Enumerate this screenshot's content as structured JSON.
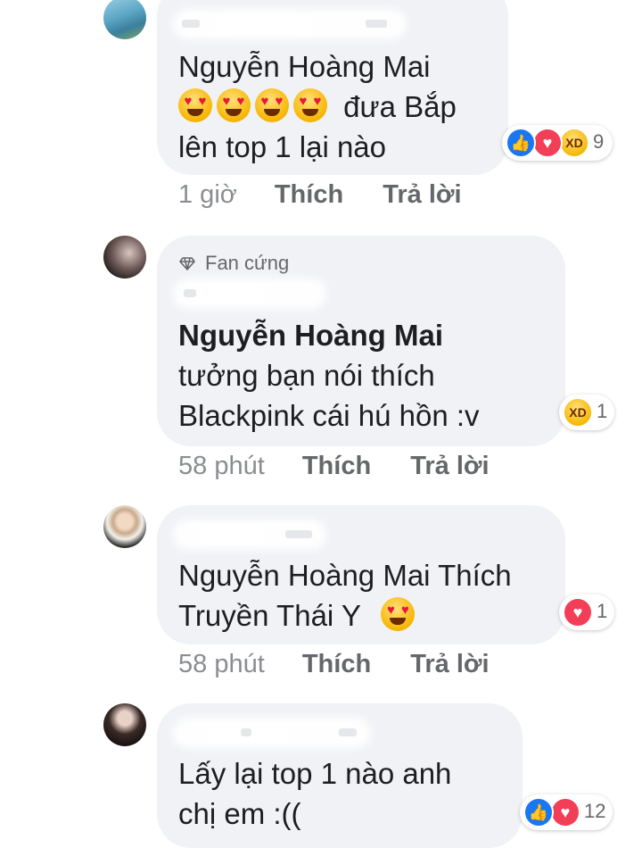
{
  "comments": [
    {
      "lines": [
        "Nguyễn Hoàng Mai",
        "đưa Bắp",
        "lên top 1 lại nào"
      ],
      "time": "1 giờ",
      "like_label": "Thích",
      "reply_label": "Trả lời",
      "reaction_count": "9",
      "reactions": [
        "like-icon",
        "love-icon",
        "haha-icon"
      ]
    },
    {
      "badge": "Fan cứng",
      "lines": [
        "Nguyễn Hoàng Mai",
        "tưởng bạn nói thích",
        "Blackpink cái hú hồn :v"
      ],
      "time": "58 phút",
      "like_label": "Thích",
      "reply_label": "Trả lời",
      "reaction_count": "1",
      "reactions": [
        "haha-icon"
      ]
    },
    {
      "lines": [
        "Nguyễn Hoàng Mai Thích",
        "Truyền Thái Y"
      ],
      "time": "58 phút",
      "like_label": "Thích",
      "reply_label": "Trả lời",
      "reaction_count": "1",
      "reactions": [
        "love-icon"
      ]
    },
    {
      "lines": [
        "Lấy lại top 1 nào anh",
        "chị em :(("
      ],
      "reaction_count": "12",
      "reactions": [
        "like-icon",
        "love-icon"
      ]
    }
  ],
  "colors": {
    "bubble": "#f0f2f5",
    "meta": "#65676b",
    "like": "#1877f2",
    "love": "#f33e58",
    "haha": "#f7b500"
  }
}
